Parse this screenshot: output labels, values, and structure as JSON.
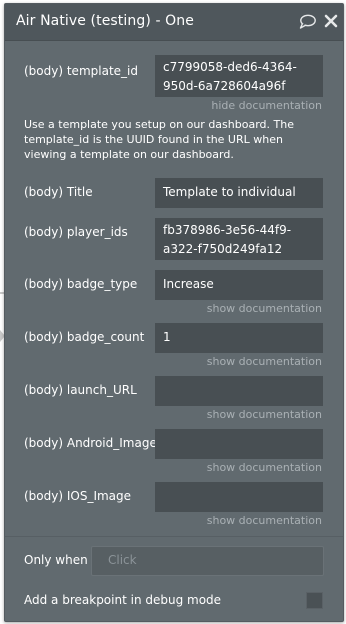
{
  "window": {
    "title": "Air Native (testing) - One"
  },
  "fields": {
    "template_id": {
      "label": "(body) template_id",
      "value": "c7799058-ded6-4364-950d-6a728604a96f",
      "doc_link": "hide documentation"
    },
    "help_text": "Use a template you setup on our dashboard. The template_id is the UUID found in the URL when viewing a template on our dashboard.",
    "title": {
      "label": "(body) Title",
      "value": "Template to individual"
    },
    "player_ids": {
      "label": "(body) player_ids",
      "value": "fb378986-3e56-44f9-a322-f750d249fa12"
    },
    "badge_type": {
      "label": "(body) badge_type",
      "value": "Increase",
      "doc_link": "show documentation"
    },
    "badge_count": {
      "label": "(body) badge_count",
      "value": "1",
      "doc_link": "show documentation"
    },
    "launch_url": {
      "label": "(body) launch_URL",
      "value": "",
      "doc_link": "show documentation"
    },
    "android_image": {
      "label": "(body) Android_Image",
      "value": "",
      "doc_link": "show documentation"
    },
    "ios_image": {
      "label": "(body) IOS_Image",
      "value": "",
      "doc_link": "show documentation"
    }
  },
  "only_when": {
    "label": "Only when",
    "placeholder": "Click"
  },
  "breakpoint": {
    "label": "Add a breakpoint in debug mode",
    "checked": false
  },
  "colors": {
    "panel_bg": "#616a6f",
    "titlebar_bg": "#4f575c",
    "field_bg": "#484f53",
    "link_text": "#a9b0b4"
  },
  "icons": {
    "comment": "comment-icon",
    "close": "close-icon"
  }
}
